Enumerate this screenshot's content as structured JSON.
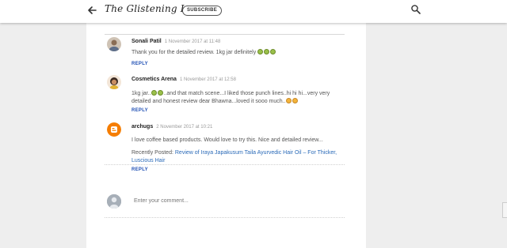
{
  "header": {
    "blog_title": "The Glistening Lane",
    "subscribe_label": "SUBSCRIBE"
  },
  "comments": [
    {
      "author": "Sonali Patil",
      "date": "1 November 2017 at 11:48",
      "text": "Thank you for the detailed review. 1kg jar definitely",
      "emoji": [
        "green",
        "green",
        "green"
      ],
      "reply": "REPLY"
    },
    {
      "author": "Cosmetics Arena",
      "date": "1 November 2017 at 12:58",
      "text_part1": "1kg jar..",
      "text_part2": "..and that match scene...I liked those punch lines..hi hi hi...very very detailed and honest review dear Bhawna...loved it sooo much..",
      "reply": "REPLY"
    },
    {
      "author": "archugs",
      "date": "2 November 2017 at 10:21",
      "text": "I love coffee based products. Would love to try this. Nice and detailed review...",
      "recent_label": "Recently Posted: ",
      "recent_link": "Review of Iraya Japakusum Taila Ayurvedic Hair Oil – For Thicker, Luscious Hair",
      "reply": "REPLY"
    }
  ],
  "compose": {
    "placeholder": "Enter your comment..."
  },
  "colors": {
    "link": "#2a6ab8",
    "reply": "#1f4fb4",
    "blogger_orange": "#f57d00"
  }
}
